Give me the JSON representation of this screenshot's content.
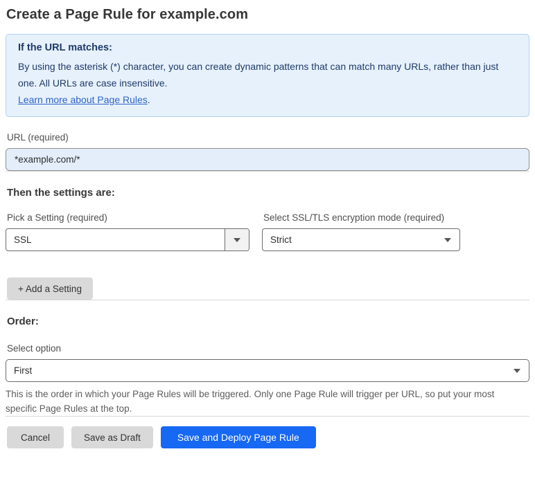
{
  "page": {
    "title": "Create a Page Rule for example.com"
  },
  "info_box": {
    "heading": "If the URL matches:",
    "body": "By using the asterisk (*) character, you can create dynamic patterns that can match many URLs, rather than just one. All URLs are case insensitive.",
    "link_label": "Learn more about Page Rules",
    "link_suffix": "."
  },
  "url_field": {
    "label": "URL (required)",
    "value": "*example.com/*"
  },
  "settings_section": {
    "heading": "Then the settings are:",
    "setting_picker": {
      "label": "Pick a Setting (required)",
      "selected": "SSL"
    },
    "ssl_mode_picker": {
      "label": "Select SSL/TLS encryption mode (required)",
      "selected": "Strict"
    },
    "add_setting_label": "+ Add a Setting"
  },
  "order_section": {
    "heading": "Order:",
    "select_label": "Select option",
    "selected": "First",
    "help_text": "This is the order in which your Page Rules will be triggered. Only one Page Rule will trigger per URL, so put your most specific Page Rules at the top."
  },
  "footer": {
    "cancel_label": "Cancel",
    "save_draft_label": "Save as Draft",
    "save_deploy_label": "Save and Deploy Page Rule"
  },
  "colors": {
    "accent_blue": "#1768f2",
    "info_box_bg": "#e7f1fc",
    "info_box_border": "#b0d2ef",
    "info_text": "#1e3a68",
    "link_blue": "#2f64c9",
    "url_input_bg": "#e4eefb",
    "gray_button_bg": "#d9d9d9"
  }
}
